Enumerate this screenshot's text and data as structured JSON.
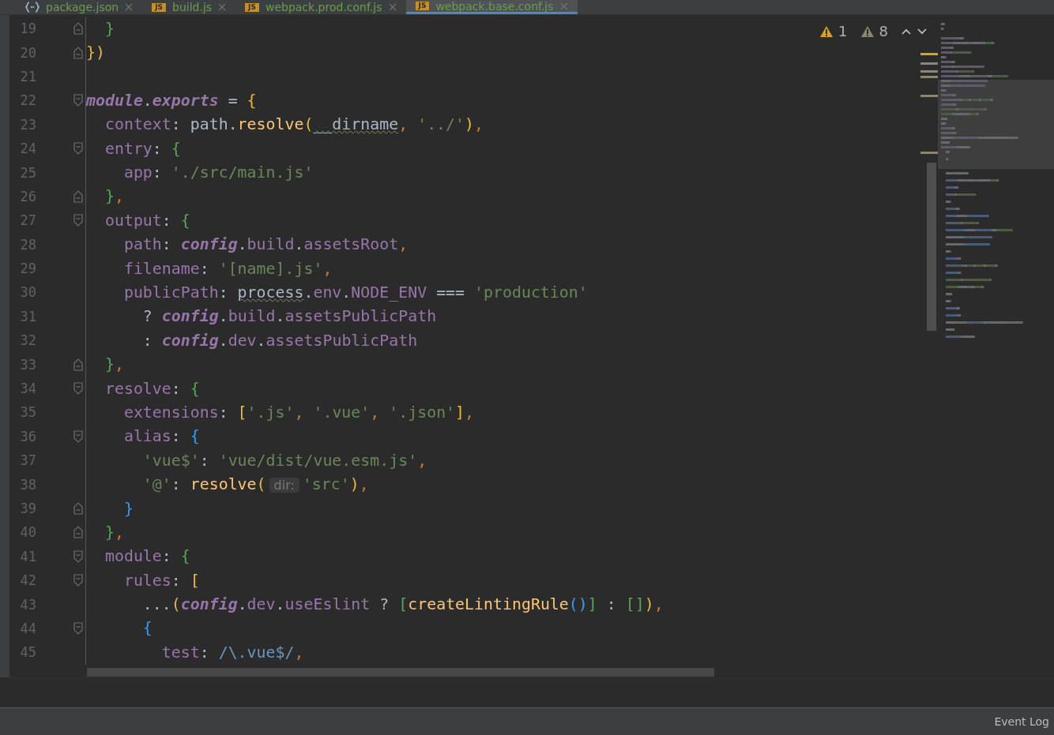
{
  "tabs": [
    {
      "label": "package.json",
      "kind": "json",
      "selected": false
    },
    {
      "label": "build.js",
      "kind": "js",
      "badge": "JS",
      "selected": false
    },
    {
      "label": "webpack.prod.conf.js",
      "kind": "js",
      "badge": "JS",
      "selected": false
    },
    {
      "label": "webpack.base.conf.js",
      "kind": "js",
      "badge": "JS",
      "selected": true
    }
  ],
  "inspections": {
    "errors": "1",
    "warnings": "8"
  },
  "lines": [
    {
      "number": "19",
      "kind": "fold-end",
      "tokens": [
        {
          "text": "  }",
          "kind": "b2"
        }
      ]
    },
    {
      "number": "20",
      "kind": "fold-end",
      "tokens": [
        {
          "text": "})",
          "kind": "b1"
        }
      ]
    },
    {
      "number": "21",
      "kind": "plain"
    },
    {
      "number": "22",
      "kind": "fold-start",
      "tokens": [
        {
          "text": "module",
          "kind": "i"
        },
        {
          "text": ".",
          "kind": "p"
        },
        {
          "text": "exports",
          "kind": "i"
        },
        {
          "text": " = ",
          "kind": "p"
        },
        {
          "text": "{",
          "kind": "b1"
        }
      ]
    },
    {
      "number": "23",
      "kind": "plain",
      "tokens": [
        {
          "text": "  context",
          "kind": "k"
        },
        {
          "text": ": path.",
          "kind": "p"
        },
        {
          "text": "resolve",
          "kind": "f"
        },
        {
          "text": "(",
          "kind": "b1"
        },
        {
          "text": "__dirname",
          "kind": "w"
        },
        {
          "text": ", ",
          "kind": "c"
        },
        {
          "text": "'../'",
          "kind": "s"
        },
        {
          "text": ")",
          "kind": "b1"
        },
        {
          "text": ",",
          "kind": "c"
        }
      ]
    },
    {
      "number": "24",
      "kind": "fold-start",
      "tokens": [
        {
          "text": "  entry",
          "kind": "k"
        },
        {
          "text": ": ",
          "kind": "p"
        },
        {
          "text": "{",
          "kind": "b2"
        }
      ]
    },
    {
      "number": "25",
      "kind": "plain",
      "tokens": [
        {
          "text": "    app",
          "kind": "k"
        },
        {
          "text": ": ",
          "kind": "p"
        },
        {
          "text": "'./src/main.js'",
          "kind": "s"
        }
      ]
    },
    {
      "number": "26",
      "kind": "fold-end",
      "tokens": [
        {
          "text": "  }",
          "kind": "b2"
        },
        {
          "text": ",",
          "kind": "c"
        }
      ]
    },
    {
      "number": "27",
      "kind": "fold-start",
      "tokens": [
        {
          "text": "  output",
          "kind": "k"
        },
        {
          "text": ": ",
          "kind": "p"
        },
        {
          "text": "{",
          "kind": "b2"
        }
      ]
    },
    {
      "number": "28",
      "kind": "plain",
      "tokens": [
        {
          "text": "    path",
          "kind": "k"
        },
        {
          "text": ": ",
          "kind": "p"
        },
        {
          "text": "config",
          "kind": "i"
        },
        {
          "text": ".",
          "kind": "p"
        },
        {
          "text": "build",
          "kind": "k"
        },
        {
          "text": ".",
          "kind": "p"
        },
        {
          "text": "assetsRoot",
          "kind": "k"
        },
        {
          "text": ",",
          "kind": "c"
        }
      ]
    },
    {
      "number": "29",
      "kind": "plain",
      "tokens": [
        {
          "text": "    filename",
          "kind": "k"
        },
        {
          "text": ": ",
          "kind": "p"
        },
        {
          "text": "'[name].js'",
          "kind": "s"
        },
        {
          "text": ",",
          "kind": "c"
        }
      ]
    },
    {
      "number": "30",
      "kind": "plain",
      "tokens": [
        {
          "text": "    publicPath",
          "kind": "k"
        },
        {
          "text": ": ",
          "kind": "p"
        },
        {
          "text": "process",
          "kind": "w"
        },
        {
          "text": ".",
          "kind": "p"
        },
        {
          "text": "env",
          "kind": "k"
        },
        {
          "text": ".",
          "kind": "p"
        },
        {
          "text": "NODE_ENV",
          "kind": "k"
        },
        {
          "text": " === ",
          "kind": "p"
        },
        {
          "text": "'production'",
          "kind": "s"
        }
      ]
    },
    {
      "number": "31",
      "kind": "plain",
      "tokens": [
        {
          "text": "      ? ",
          "kind": "p"
        },
        {
          "text": "config",
          "kind": "i"
        },
        {
          "text": ".",
          "kind": "p"
        },
        {
          "text": "build",
          "kind": "k"
        },
        {
          "text": ".",
          "kind": "p"
        },
        {
          "text": "assetsPublicPath",
          "kind": "k"
        }
      ]
    },
    {
      "number": "32",
      "kind": "plain",
      "tokens": [
        {
          "text": "      : ",
          "kind": "p"
        },
        {
          "text": "config",
          "kind": "i"
        },
        {
          "text": ".",
          "kind": "p"
        },
        {
          "text": "dev",
          "kind": "k"
        },
        {
          "text": ".",
          "kind": "p"
        },
        {
          "text": "assetsPublicPath",
          "kind": "k"
        }
      ]
    },
    {
      "number": "33",
      "kind": "fold-end",
      "tokens": [
        {
          "text": "  }",
          "kind": "b2"
        },
        {
          "text": ",",
          "kind": "c"
        }
      ]
    },
    {
      "number": "34",
      "kind": "fold-start",
      "tokens": [
        {
          "text": "  resolve",
          "kind": "k"
        },
        {
          "text": ": ",
          "kind": "p"
        },
        {
          "text": "{",
          "kind": "b2"
        }
      ]
    },
    {
      "number": "35",
      "kind": "plain",
      "tokens": [
        {
          "text": "    extensions",
          "kind": "k"
        },
        {
          "text": ": ",
          "kind": "p"
        },
        {
          "text": "[",
          "kind": "b1"
        },
        {
          "text": "'.js'",
          "kind": "s"
        },
        {
          "text": ", ",
          "kind": "c"
        },
        {
          "text": "'.vue'",
          "kind": "s"
        },
        {
          "text": ", ",
          "kind": "c"
        },
        {
          "text": "'.json'",
          "kind": "s"
        },
        {
          "text": "]",
          "kind": "b1"
        },
        {
          "text": ",",
          "kind": "c"
        }
      ]
    },
    {
      "number": "36",
      "kind": "fold-start",
      "tokens": [
        {
          "text": "    alias",
          "kind": "k"
        },
        {
          "text": ": ",
          "kind": "p"
        },
        {
          "text": "{",
          "kind": "b3"
        }
      ]
    },
    {
      "number": "37",
      "kind": "plain",
      "tokens": [
        {
          "text": "      'vue$'",
          "kind": "s"
        },
        {
          "text": ": ",
          "kind": "p"
        },
        {
          "text": "'vue/dist/vue.esm.js'",
          "kind": "s"
        },
        {
          "text": ",",
          "kind": "c"
        }
      ]
    },
    {
      "number": "38",
      "kind": "plain",
      "tokens": [
        {
          "text": "      '@'",
          "kind": "s"
        },
        {
          "text": ": ",
          "kind": "p"
        },
        {
          "text": "resolve",
          "kind": "f"
        },
        {
          "text": "(",
          "kind": "b1"
        },
        {
          "text": "dir:",
          "kind": "h"
        },
        {
          "text": "'src'",
          "kind": "s"
        },
        {
          "text": ")",
          "kind": "b1"
        },
        {
          "text": ",",
          "kind": "c"
        }
      ]
    },
    {
      "number": "39",
      "kind": "fold-end",
      "tokens": [
        {
          "text": "    }",
          "kind": "b3"
        }
      ]
    },
    {
      "number": "40",
      "kind": "fold-end",
      "tokens": [
        {
          "text": "  }",
          "kind": "b2"
        },
        {
          "text": ",",
          "kind": "c"
        }
      ]
    },
    {
      "number": "41",
      "kind": "fold-start",
      "tokens": [
        {
          "text": "  module",
          "kind": "k"
        },
        {
          "text": ": ",
          "kind": "p"
        },
        {
          "text": "{",
          "kind": "b2"
        }
      ]
    },
    {
      "number": "42",
      "kind": "fold-start",
      "tokens": [
        {
          "text": "    rules",
          "kind": "k"
        },
        {
          "text": ": ",
          "kind": "p"
        },
        {
          "text": "[",
          "kind": "b1"
        }
      ]
    },
    {
      "number": "43",
      "kind": "plain",
      "tokens": [
        {
          "text": "      ...",
          "kind": "p"
        },
        {
          "text": "(",
          "kind": "b1"
        },
        {
          "text": "config",
          "kind": "i"
        },
        {
          "text": ".",
          "kind": "p"
        },
        {
          "text": "dev",
          "kind": "k"
        },
        {
          "text": ".",
          "kind": "p"
        },
        {
          "text": "useEslint",
          "kind": "k"
        },
        {
          "text": " ? ",
          "kind": "p"
        },
        {
          "text": "[",
          "kind": "b2"
        },
        {
          "text": "createLintingRule",
          "kind": "f"
        },
        {
          "text": "()",
          "kind": "b3"
        },
        {
          "text": "]",
          "kind": "b2"
        },
        {
          "text": " : ",
          "kind": "p"
        },
        {
          "text": "[]",
          "kind": "b2"
        },
        {
          "text": ")",
          "kind": "b1"
        },
        {
          "text": ",",
          "kind": "c"
        }
      ]
    },
    {
      "number": "44",
      "kind": "fold-start",
      "tokens": [
        {
          "text": "      {",
          "kind": "b3"
        }
      ]
    },
    {
      "number": "45",
      "kind": "plain",
      "tokens": [
        {
          "text": "        test",
          "kind": "k"
        },
        {
          "text": ": ",
          "kind": "p"
        },
        {
          "text": "/\\.vue$/",
          "kind": "r"
        },
        {
          "text": ",",
          "kind": "c"
        }
      ]
    }
  ],
  "status_bar": {
    "event_log": "Event Log"
  }
}
